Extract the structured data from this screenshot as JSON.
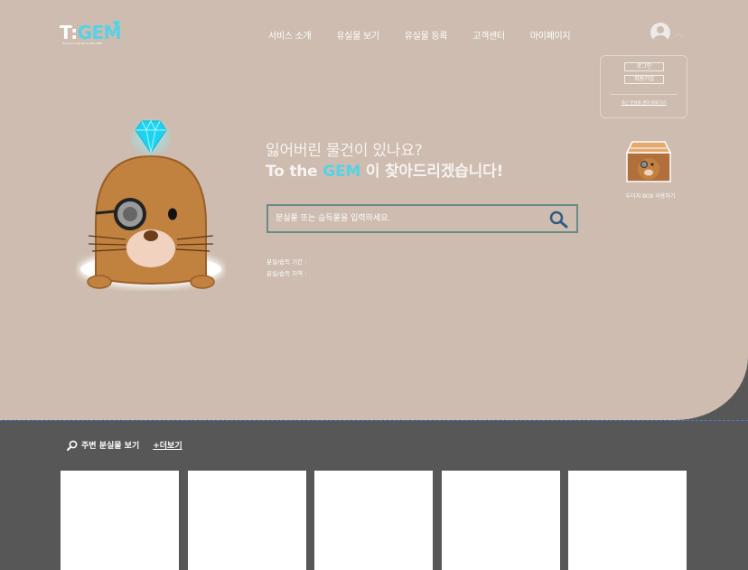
{
  "logo": {
    "brand_prefix": "T",
    "brand_sep": ":",
    "brand_suffix": "GEM",
    "tagline": "find your lost items with GEM"
  },
  "nav": {
    "items": [
      "서비스 소개",
      "유실물 보기",
      "유실물 등록",
      "고객센터",
      "마이페이지"
    ]
  },
  "account": {
    "login_label": "로그인",
    "signup_label": "회원가입",
    "lost_center_link": "최근 분실물 센터 바로가기"
  },
  "box_service": {
    "label": "두더지 BOX 이용하기"
  },
  "hero": {
    "line1": "잃어버린 물건이 있나요?",
    "line2_prefix": "To the ",
    "line2_gem": "GEM",
    "line2_suffix": " 이 찾아드리겠습니다!"
  },
  "search": {
    "placeholder": "분실물 또는 습득물을 입력하세요."
  },
  "filters": {
    "period_label": "분실/습득 기간 :",
    "region_label": "분실/습득 지역 :"
  },
  "nearby": {
    "title": "주변 분실물 보기",
    "more_label": "+더보기"
  },
  "colors": {
    "hero_bg": "#cdbcaf",
    "accent": "#55d2e8",
    "footer_bg": "#575757",
    "search_border": "#6a8b87"
  },
  "icons": {
    "diamond": "diamond-icon",
    "search": "search-icon",
    "profile": "user-icon",
    "box": "mole-box-icon"
  }
}
